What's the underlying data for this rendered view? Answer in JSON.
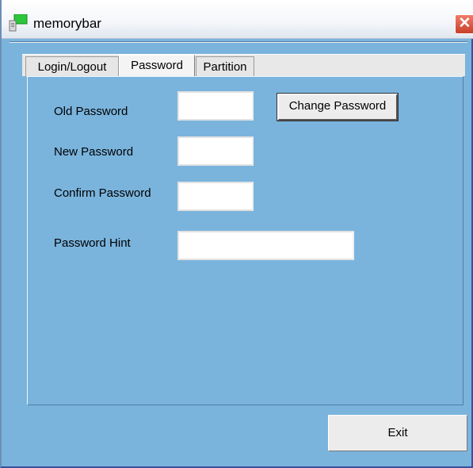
{
  "window": {
    "title": "memorybar",
    "icon": "app-window-icon",
    "close_glyph": "✕"
  },
  "tabs": [
    {
      "label": "Login/Logout",
      "active": false
    },
    {
      "label": "Password",
      "active": true
    },
    {
      "label": "Partition",
      "active": false
    }
  ],
  "password_form": {
    "old_label": "Old Password",
    "old_value": "",
    "new_label": "New Password",
    "new_value": "",
    "confirm_label": "Confirm Password",
    "confirm_value": "",
    "hint_label": "Password Hint",
    "hint_value": "",
    "change_button": "Change Password"
  },
  "footer": {
    "exit_label": "Exit"
  },
  "colors": {
    "window_bg": "#7ab4dd",
    "close_red": "#d9533c"
  }
}
